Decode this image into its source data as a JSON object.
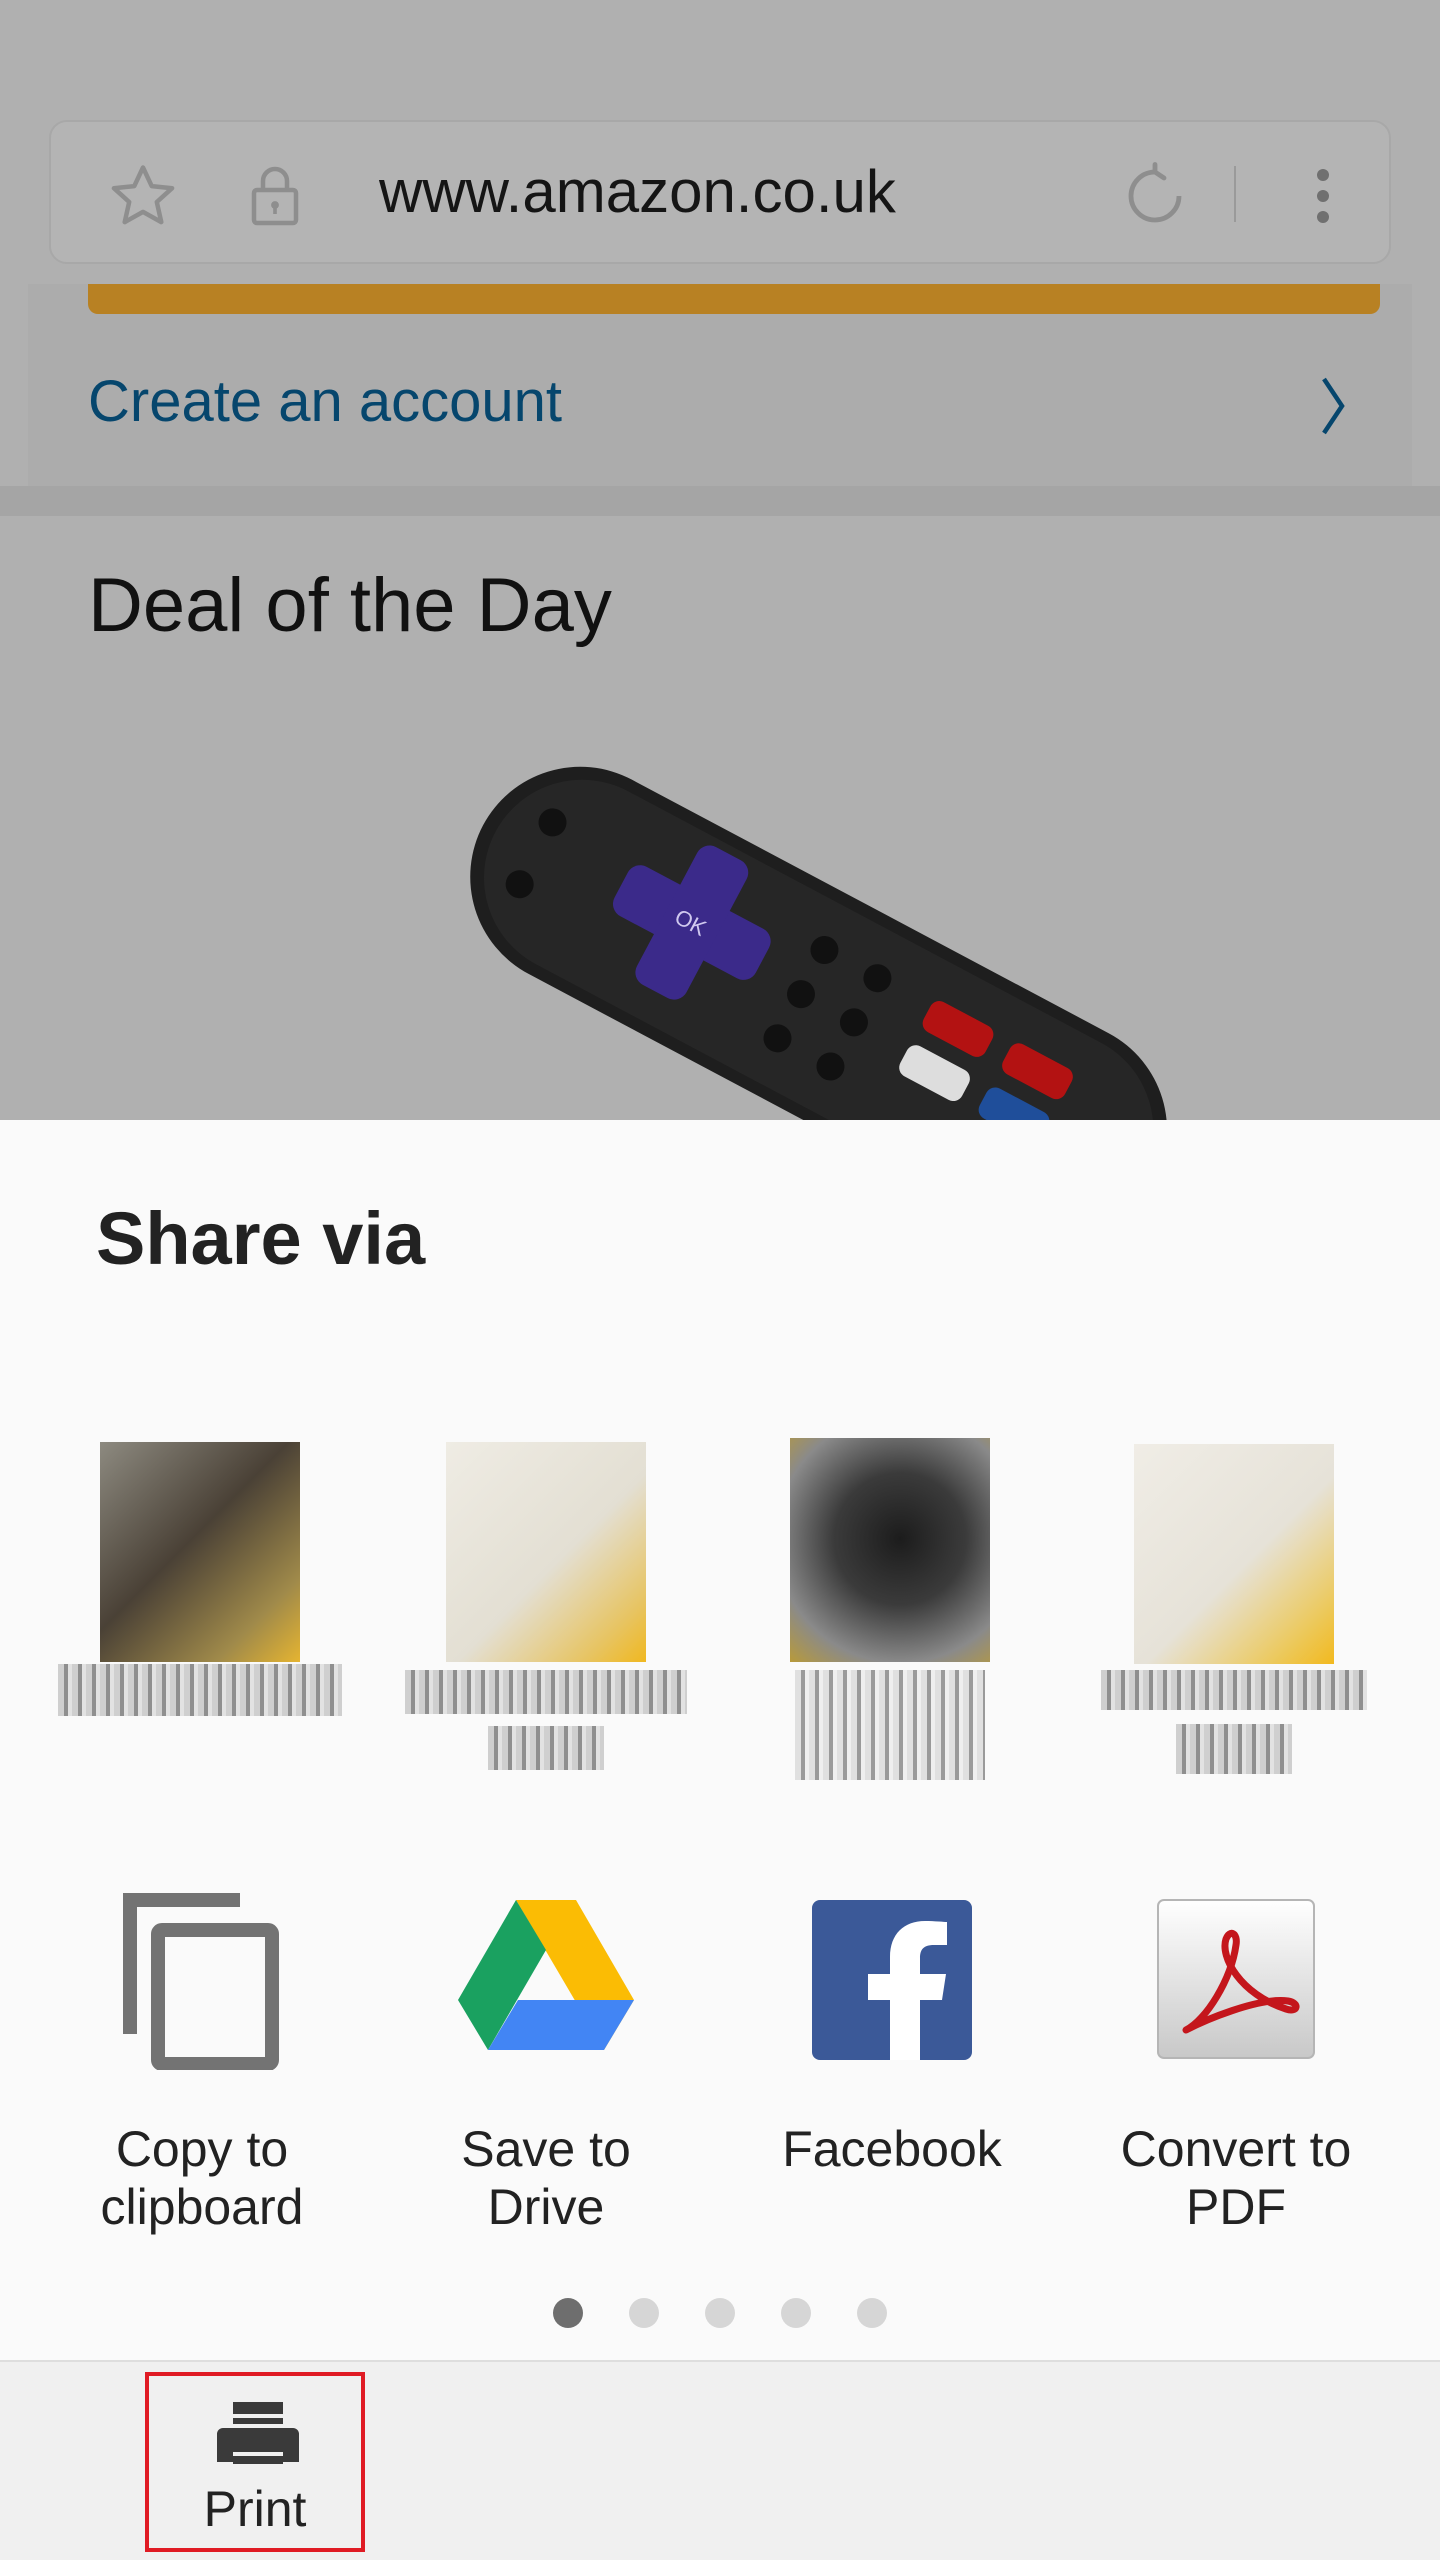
{
  "browser": {
    "url": "www.amazon.co.uk"
  },
  "background_page": {
    "create_account_link": "Create an account",
    "deal_section_title": "Deal of the Day",
    "product_image": "streaming-remote-image"
  },
  "share_sheet": {
    "title": "Share via",
    "contacts": [
      {
        "avatar": "blurred-contact-avatar",
        "name": "",
        "lines": 1
      },
      {
        "avatar": "blurred-contact-avatar",
        "name": "",
        "lines": 2
      },
      {
        "avatar": "blurred-contact-avatar",
        "name": "",
        "lines": 2
      },
      {
        "avatar": "blurred-contact-avatar",
        "name": "",
        "lines": 2
      }
    ],
    "apps": [
      {
        "label": "Copy to\nclipboard",
        "icon": "copy-icon"
      },
      {
        "label": "Save to\nDrive",
        "icon": "google-drive-icon"
      },
      {
        "label": "Facebook",
        "icon": "facebook-icon"
      },
      {
        "label": "Convert to\nPDF",
        "icon": "pdf-icon"
      }
    ],
    "page_indicator": {
      "total": 5,
      "active": 1
    }
  },
  "bottom_bar": {
    "print_label": "Print"
  },
  "colors": {
    "scrim": "#b0b0b0",
    "link": "#06466d",
    "highlight": "#e01b24",
    "facebook": "#3b5998",
    "sheet_bg": "#fafafa"
  }
}
